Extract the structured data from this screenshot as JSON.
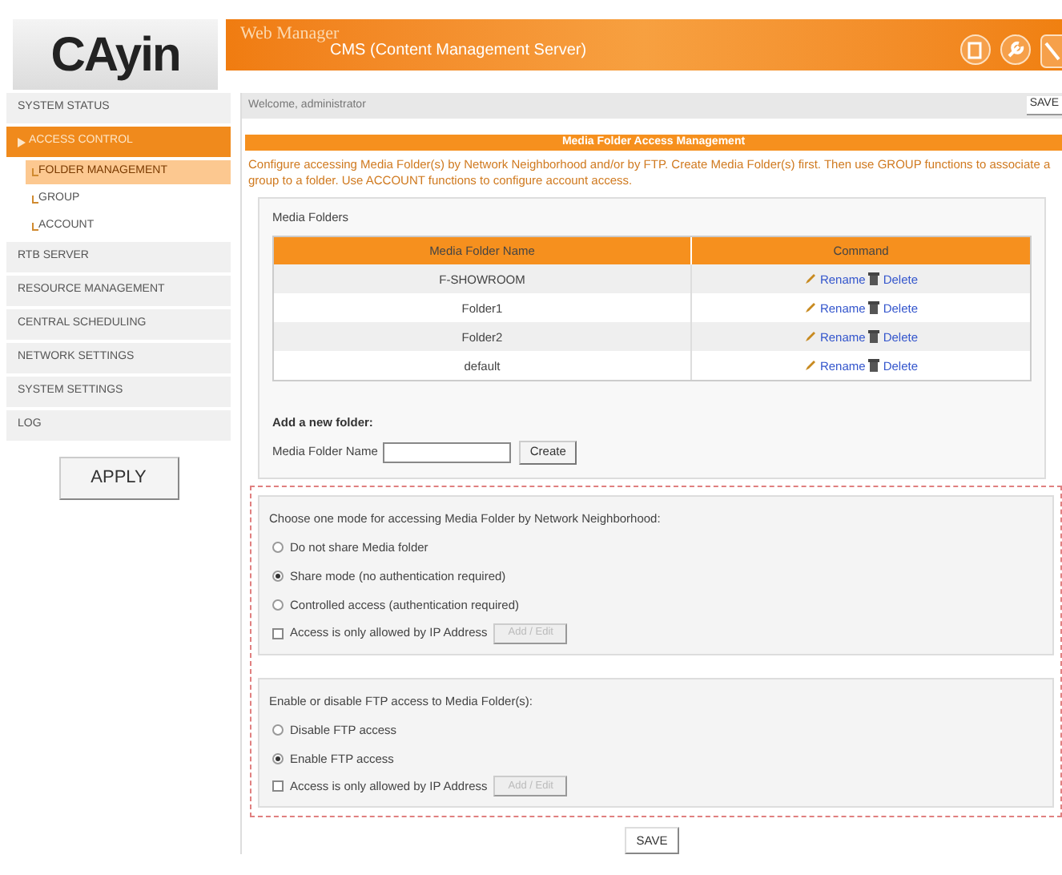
{
  "header": {
    "logo": "CAyin",
    "app_name": "Web Manager",
    "product": "CMS (Content Management Server)"
  },
  "sidebar": {
    "items": [
      {
        "label": "SYSTEM STATUS",
        "selected": false
      },
      {
        "label": "ACCESS CONTROL",
        "selected": true,
        "children": [
          {
            "label": "FOLDER MANAGEMENT",
            "selected": true
          },
          {
            "label": "GROUP",
            "selected": false
          },
          {
            "label": "ACCOUNT",
            "selected": false
          }
        ]
      },
      {
        "label": "RTB SERVER",
        "selected": false
      },
      {
        "label": "RESOURCE MANAGEMENT",
        "selected": false
      },
      {
        "label": "CENTRAL SCHEDULING",
        "selected": false
      },
      {
        "label": "NETWORK SETTINGS",
        "selected": false
      },
      {
        "label": "SYSTEM SETTINGS",
        "selected": false
      },
      {
        "label": "LOG",
        "selected": false
      }
    ],
    "apply_button": "APPLY"
  },
  "top_bar": {
    "welcome": "Welcome, administrator",
    "save_button": "SAVE"
  },
  "panel": {
    "title": "Media Folder Access Management",
    "description": "Configure accessing Media Folder(s) by Network Neighborhood and/or by FTP. Create Media Folder(s) first. Then use GROUP functions to associate a group to a folder. Use ACCOUNT functions to configure account access.",
    "media_folders": {
      "title": "Media Folders",
      "columns": [
        "Media Folder Name",
        "Command"
      ],
      "rows": [
        {
          "name": "F-SHOWROOM",
          "rename": "Rename",
          "delete": "Delete"
        },
        {
          "name": "Folder1",
          "rename": "Rename",
          "delete": "Delete"
        },
        {
          "name": "Folder2",
          "rename": "Rename",
          "delete": "Delete"
        },
        {
          "name": "default",
          "rename": "Rename",
          "delete": "Delete"
        }
      ]
    },
    "add_folder": {
      "title": "Add a new folder:",
      "label": "Media Folder Name",
      "button": "Create"
    },
    "sections": [
      {
        "title": "Choose one mode for accessing Media Folder by Network Neighborhood:",
        "options": [
          {
            "label": "Do not share Media folder",
            "selected": false
          },
          {
            "label": "Share mode (no authentication required)",
            "selected": true
          },
          {
            "label": "Controlled access (authentication required)",
            "selected": false
          }
        ],
        "ip_restriction": {
          "label": "Access is only allowed by IP Address",
          "checked": false,
          "button": "Add / Edit",
          "disabled": true
        }
      },
      {
        "title": "Enable or disable FTP access to Media Folder(s):",
        "options": [
          {
            "label": "Disable FTP access",
            "selected": false
          },
          {
            "label": "Enable FTP access",
            "selected": true
          }
        ],
        "ip_restriction": {
          "label": "Access is only allowed by IP Address",
          "checked": false,
          "button": "Add / Edit",
          "disabled": true
        }
      }
    ],
    "save_button": "SAVE"
  }
}
